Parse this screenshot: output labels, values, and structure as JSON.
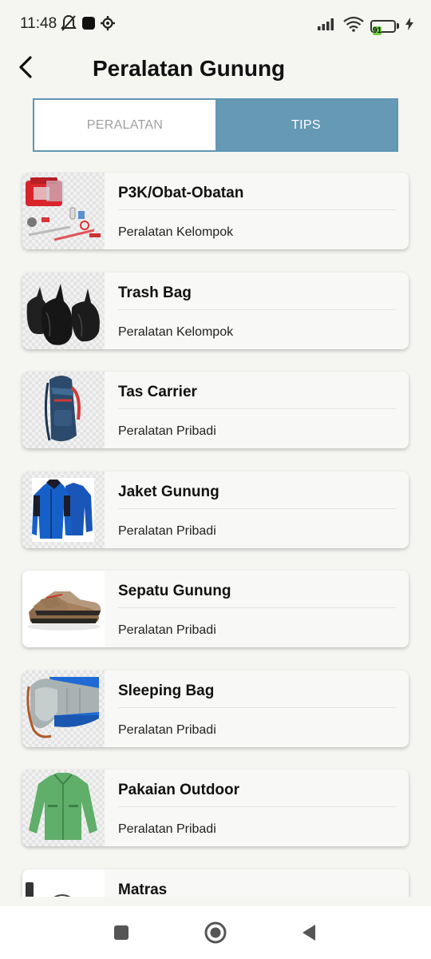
{
  "status_bar": {
    "time": "11:48",
    "battery_level": "91",
    "icons": [
      "bell-off-icon",
      "app-square-icon",
      "gear-icon",
      "signal-icon",
      "wifi-icon",
      "battery-icon",
      "charging-icon"
    ]
  },
  "header": {
    "title": "Peralatan Gunung",
    "back_icon": "chevron-left-icon"
  },
  "tabs": [
    {
      "label": "PERALATAN",
      "active": false
    },
    {
      "label": "TIPS",
      "active": true
    }
  ],
  "items": [
    {
      "title": "P3K/Obat-Obatan",
      "subtitle": "Peralatan Kelompok",
      "image": "first-aid-kit"
    },
    {
      "title": "Trash Bag",
      "subtitle": "Peralatan Kelompok",
      "image": "trash-bags"
    },
    {
      "title": "Tas Carrier",
      "subtitle": "Peralatan Pribadi",
      "image": "backpack"
    },
    {
      "title": "Jaket Gunung",
      "subtitle": "Peralatan Pribadi",
      "image": "jackets"
    },
    {
      "title": "Sepatu Gunung",
      "subtitle": "Peralatan Pribadi",
      "image": "hiking-shoes"
    },
    {
      "title": "Sleeping Bag",
      "subtitle": "Peralatan Pribadi",
      "image": "sleeping-bag"
    },
    {
      "title": "Pakaian Outdoor",
      "subtitle": "Peralatan Pribadi",
      "image": "green-jacket"
    },
    {
      "title": "Matras",
      "subtitle": "",
      "image": "mattress"
    }
  ],
  "nav_bar": {
    "buttons": [
      "recents-square-icon",
      "home-circle-icon",
      "back-triangle-icon"
    ]
  },
  "colors": {
    "background": "#f5f5f2",
    "tab_active": "#6599b4",
    "tab_border": "#5f96b4",
    "tab_inactive_text": "#a0a0a0"
  }
}
